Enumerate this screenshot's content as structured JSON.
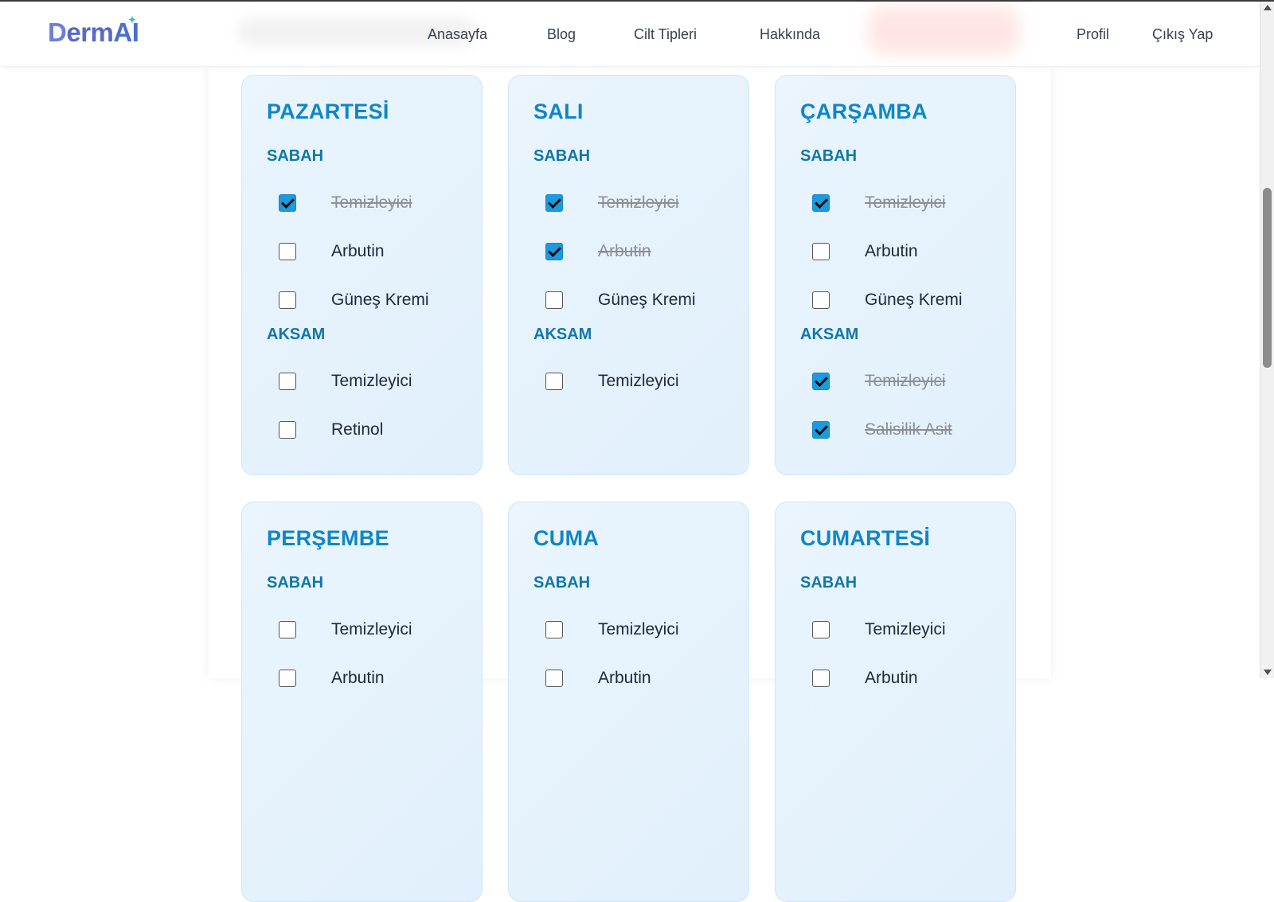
{
  "nav": {
    "logo": {
      "d": "D",
      "erm": "erm",
      "ai": "AI"
    },
    "links": [
      "Anasayfa",
      "Blog",
      "Cilt Tipleri",
      "Hakkında"
    ],
    "profile": "Profil",
    "logout": "Çıkış Yap"
  },
  "days": [
    {
      "name": "PAZARTESİ",
      "morning_label": "SABAH",
      "morning": [
        {
          "label": "Temizleyici",
          "checked": true
        },
        {
          "label": "Arbutin",
          "checked": false
        },
        {
          "label": "Güneş Kremi",
          "checked": false
        }
      ],
      "evening_label": "AKSAM",
      "evening": [
        {
          "label": "Temizleyici",
          "checked": false
        },
        {
          "label": "Retinol",
          "checked": false
        }
      ]
    },
    {
      "name": "SALI",
      "morning_label": "SABAH",
      "morning": [
        {
          "label": "Temizleyici",
          "checked": true
        },
        {
          "label": "Arbutin",
          "checked": true
        },
        {
          "label": "Güneş Kremi",
          "checked": false
        }
      ],
      "evening_label": "AKSAM",
      "evening": [
        {
          "label": "Temizleyici",
          "checked": false
        }
      ]
    },
    {
      "name": "ÇARŞAMBA",
      "morning_label": "SABAH",
      "morning": [
        {
          "label": "Temizleyici",
          "checked": true
        },
        {
          "label": "Arbutin",
          "checked": false
        },
        {
          "label": "Güneş Kremi",
          "checked": false
        }
      ],
      "evening_label": "AKSAM",
      "evening": [
        {
          "label": "Temizleyici",
          "checked": true
        },
        {
          "label": "Salisilik Asit",
          "checked": true
        }
      ]
    },
    {
      "name": "PERŞEMBE",
      "morning_label": "SABAH",
      "morning": [
        {
          "label": "Temizleyici",
          "checked": false
        },
        {
          "label": "Arbutin",
          "checked": false
        }
      ]
    },
    {
      "name": "CUMA",
      "morning_label": "SABAH",
      "morning": [
        {
          "label": "Temizleyici",
          "checked": false
        },
        {
          "label": "Arbutin",
          "checked": false
        }
      ]
    },
    {
      "name": "CUMARTESİ",
      "morning_label": "SABAH",
      "morning": [
        {
          "label": "Temizleyici",
          "checked": false
        },
        {
          "label": "Arbutin",
          "checked": false
        }
      ]
    }
  ],
  "colors": {
    "accent": "#0f86c8",
    "section": "#1277a8",
    "checkbox_on": "#1a9be0",
    "card_bg": "#e6f3fc"
  }
}
